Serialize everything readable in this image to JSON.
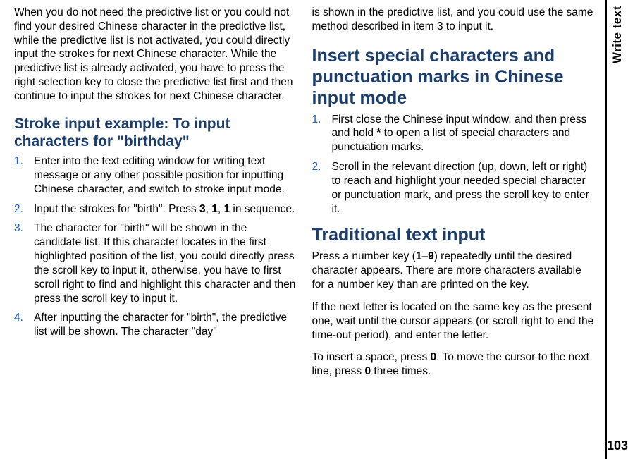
{
  "sidebar": {
    "label": "Write text",
    "page_number": "103"
  },
  "left_column": {
    "intro_paragraph": "When you do not need the predictive list or you could not find your desired Chinese character in the predictive list, while the predictive list is not activated, you could directly input the strokes for next Chinese character. While the predictive list is already activated, you have to press the right selection key to close the predictive list first and then continue to input the strokes for next Chinese character.",
    "heading1": "Stroke input example: To input characters for \"birthday\"",
    "list": {
      "item1": "Enter into the text editing window for writing text message or any other possible position for inputting Chinese character, and switch to stroke input mode.",
      "item2_pre": "Input the strokes for \"birth\": Press ",
      "item2_key1": "3",
      "item2_sep1": ", ",
      "item2_key2": "1",
      "item2_sep2": ", ",
      "item2_key3": "1",
      "item2_post": " in sequence.",
      "item3": "The character for \"birth\" will be shown in the candidate list. If this character locates in the first highlighted position of the list, you could directly press the scroll key to input it, otherwise, you have to first scroll right to find and highlight this character and then press the scroll key to input it.",
      "item4": "After inputting the character for \"birth\", the predictive list will be shown. The character \"day\""
    }
  },
  "right_column": {
    "continuation": "is shown in the predictive list, and you could use the same method described in item 3 to input it.",
    "heading1": "Insert special characters and punctuation marks in Chinese input mode",
    "list1": {
      "item1_pre": "First close the Chinese input window, and then press and hold ",
      "item1_key": "*",
      "item1_post": " to open a list of special characters and punctuation marks.",
      "item2": "Scroll in the relevant direction (up, down, left or right) to reach and highlight your needed special character or punctuation mark, and press the scroll key to enter it."
    },
    "heading2": "Traditional text input",
    "para1_pre": "Press a number key (",
    "para1_key1": "1",
    "para1_dash": "–",
    "para1_key2": "9",
    "para1_post": ") repeatedly until the desired character appears. There are more characters available for a number key than are printed on the key.",
    "para2": "If the next letter is located on the same key as the present one, wait until the cursor appears (or scroll right to end the time-out period), and enter the letter.",
    "para3_pre": "To insert a space, press ",
    "para3_key1": "0",
    "para3_mid": ". To move the cursor to the next line, press ",
    "para3_key2": "0",
    "para3_post": " three times."
  }
}
